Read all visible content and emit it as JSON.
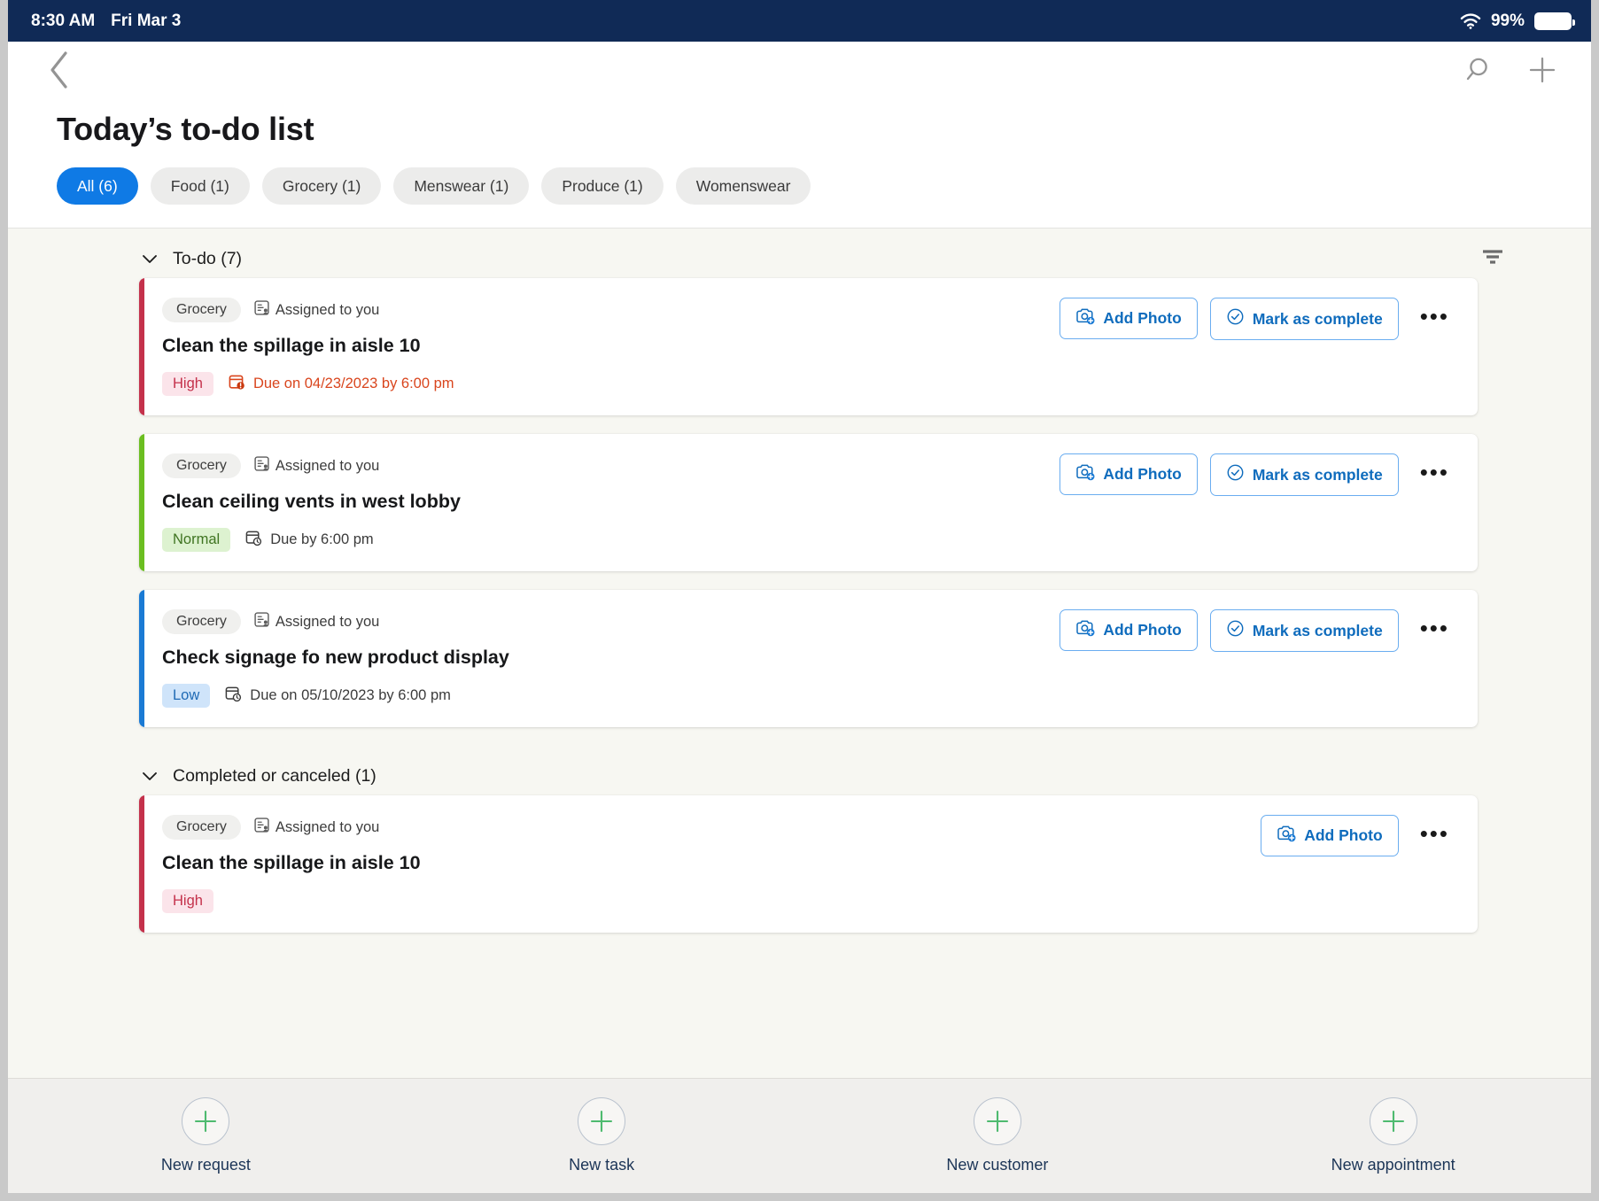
{
  "statusbar": {
    "time": "8:30 AM",
    "date": "Fri Mar 3",
    "battery_percent": "99%",
    "wifi_icon": "wifi-icon",
    "battery_icon": "battery-icon"
  },
  "header": {
    "back_icon": "chevron-left-icon",
    "search_icon": "search-icon",
    "add_icon": "plus-icon",
    "title": "Today’s to-do list"
  },
  "chips": [
    {
      "label": "All (6)",
      "active": true
    },
    {
      "label": "Food (1)",
      "active": false
    },
    {
      "label": "Grocery (1)",
      "active": false
    },
    {
      "label": "Menswear (1)",
      "active": false
    },
    {
      "label": "Produce (1)",
      "active": false
    },
    {
      "label": "Womenswear",
      "active": false
    }
  ],
  "sections": [
    {
      "title": "To-do (7)",
      "collapse_icon": "chevron-down-icon",
      "filter_icon": "filter-icon",
      "has_filter": true,
      "cards": [
        {
          "accent": "#c4314b",
          "tag": "Grocery",
          "assigned": "Assigned to you",
          "assigned_icon": "assigned-task-icon",
          "title": "Clean the spillage in aisle 10",
          "priority": "High",
          "priority_class": "prio-high",
          "due": "Due on 04/23/2023 by 6:00 pm",
          "due_overdue": true,
          "due_icon": "calendar-alert-icon",
          "buttons": [
            {
              "label": "Add Photo",
              "icon": "camera-add-icon"
            },
            {
              "label": "Mark as complete",
              "icon": "check-circle-icon"
            }
          ],
          "overflow_label": "•••"
        },
        {
          "accent": "#6bbe20",
          "tag": "Grocery",
          "assigned": "Assigned to you",
          "assigned_icon": "assigned-task-icon",
          "title": "Clean ceiling vents in west lobby",
          "priority": "Normal",
          "priority_class": "prio-normal",
          "due": "Due by 6:00 pm",
          "due_overdue": false,
          "due_icon": "calendar-clock-icon",
          "buttons": [
            {
              "label": "Add Photo",
              "icon": "camera-add-icon"
            },
            {
              "label": "Mark as complete",
              "icon": "check-circle-icon"
            }
          ],
          "overflow_label": "•••"
        },
        {
          "accent": "#1a7ad4",
          "tag": "Grocery",
          "assigned": "Assigned to you",
          "assigned_icon": "assigned-task-icon",
          "title": "Check signage fo new product display",
          "priority": "Low",
          "priority_class": "prio-low",
          "due": "Due on 05/10/2023 by 6:00 pm",
          "due_overdue": false,
          "due_icon": "calendar-clock-icon",
          "buttons": [
            {
              "label": "Add Photo",
              "icon": "camera-add-icon"
            },
            {
              "label": "Mark as complete",
              "icon": "check-circle-icon"
            }
          ],
          "overflow_label": "•••"
        }
      ]
    },
    {
      "title": "Completed or canceled (1)",
      "collapse_icon": "chevron-down-icon",
      "has_filter": false,
      "cards": [
        {
          "accent": "#c4314b",
          "tag": "Grocery",
          "assigned": "Assigned to you",
          "assigned_icon": "assigned-task-icon",
          "title": "Clean the spillage in aisle 10",
          "priority": "High",
          "priority_class": "prio-high",
          "due": "",
          "due_overdue": false,
          "due_icon": "",
          "buttons": [
            {
              "label": "Add Photo",
              "icon": "camera-add-icon"
            }
          ],
          "overflow_label": "•••"
        }
      ]
    }
  ],
  "bottombar": [
    {
      "label": "New request",
      "icon": "plus-circle-icon"
    },
    {
      "label": "New task",
      "icon": "plus-circle-icon"
    },
    {
      "label": "New customer",
      "icon": "plus-circle-icon"
    },
    {
      "label": "New appointment",
      "icon": "plus-circle-icon"
    }
  ],
  "colors": {
    "statusbar_bg": "#102a56",
    "accent_blue": "#0f7ae5",
    "link_blue": "#0f6cbd",
    "content_bg": "#f7f7f2",
    "high": "#c4314b",
    "normal": "#6bbe20",
    "low": "#1a7ad4",
    "overdue_text": "#d9451d",
    "bottom_plus_green": "#4eba6f"
  }
}
